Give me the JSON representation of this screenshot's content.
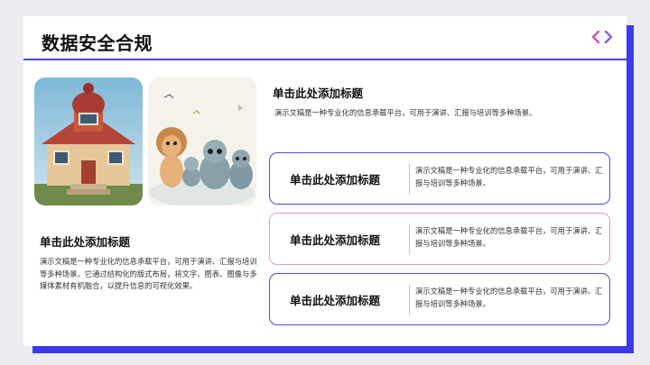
{
  "slide": {
    "title": "数据安全合规"
  },
  "icons": {
    "nav": "chevron-left-right-icon",
    "nav_color": "#d24fb0"
  },
  "left_section": {
    "heading": "单击此处添加标题",
    "body": "演示文稿是一种专业化的信息承载平台，可用于演讲、汇报与培训等多种场景。它通过结构化的版式布局，将文字、图表、图像与多媒体素材有机融合，以提升信息的可视化效果。"
  },
  "right_section": {
    "heading": "单击此处添加标题",
    "body": "演示文稿是一种专业化的信息承载平台，可用于演讲、汇报与培训等多种场景。"
  },
  "cards": [
    {
      "heading": "单击此处添加标题",
      "body": "演示文稿是一种专业化的信息承载平台，可用于演讲、汇报与培训等多种场景。",
      "border": "#4a4af0"
    },
    {
      "heading": "单击此处添加标题",
      "body": "演示文稿是一种专业化的信息承载平台，可用于演讲、汇报与培训等多种场景。",
      "border": "#e39ac6"
    },
    {
      "heading": "单击此处添加标题",
      "body": "演示文稿是一种专业化的信息承载平台，可用于演讲、汇报与培训等多种场景。",
      "border": "#4a4af0"
    }
  ],
  "colors": {
    "accent": "#4a4af0",
    "shadow": "#3b3bea",
    "pink": "#e39ac6"
  }
}
